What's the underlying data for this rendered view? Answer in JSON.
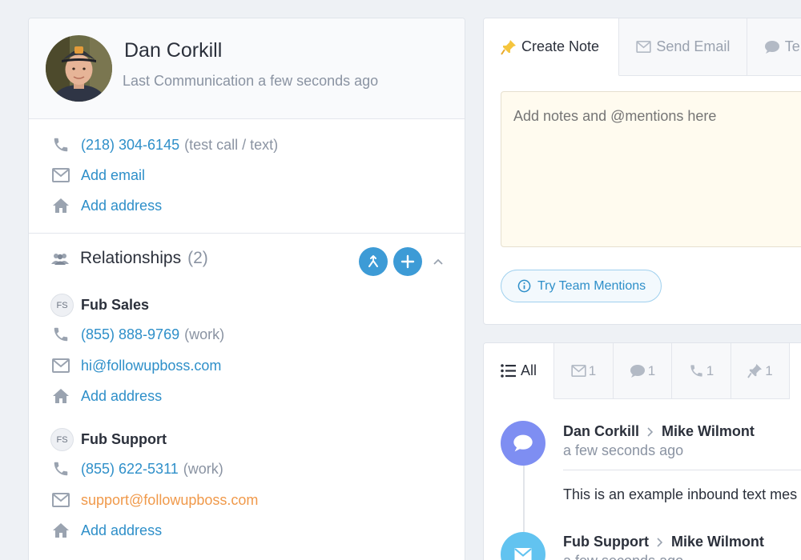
{
  "profile": {
    "name": "Dan Corkill",
    "last_communication": "Last Communication a few seconds ago"
  },
  "contact": {
    "phone": "(218) 304-6145",
    "phone_note": "(test call / text)",
    "add_email": "Add email",
    "add_address": "Add address"
  },
  "relationships": {
    "title": "Relationships",
    "count": "(2)",
    "items": [
      {
        "initials": "FS",
        "name": "Fub Sales",
        "phone": "(855) 888-9769",
        "phone_type": "(work)",
        "email": "hi@followupboss.com",
        "add_address": "Add address"
      },
      {
        "initials": "FS",
        "name": "Fub Support",
        "phone": "(855) 622-5311",
        "phone_type": "(work)",
        "email": "support@followupboss.com",
        "add_address": "Add address"
      }
    ]
  },
  "composer": {
    "tabs": [
      {
        "label": "Create Note",
        "icon": "pin-icon"
      },
      {
        "label": "Send Email",
        "icon": "envelope-icon"
      },
      {
        "label": "Te",
        "icon": "chat-icon"
      }
    ],
    "placeholder": "Add notes and @mentions here",
    "mentions_button": "Try Team Mentions"
  },
  "feed": {
    "tabs": [
      {
        "label": "All",
        "icon": "list-icon"
      },
      {
        "label": "1",
        "icon": "envelope-icon"
      },
      {
        "label": "1",
        "icon": "chat-icon"
      },
      {
        "label": "1",
        "icon": "phone-icon"
      },
      {
        "label": "1",
        "icon": "pin-icon"
      }
    ],
    "entries": [
      {
        "from": "Dan Corkill",
        "to": "Mike Wilmont",
        "time": "a few seconds ago",
        "text": "This is an example inbound text mes",
        "icon": "chat-icon"
      },
      {
        "from": "Fub Support",
        "to": "Mike Wilmont",
        "time": "a few seconds ago",
        "icon": "envelope-icon"
      }
    ]
  },
  "colors": {
    "accent": "#2e8fc9",
    "button_blue": "#3d9bd6",
    "chat_purple": "#7e8ef2",
    "email_blue": "#62c3f0",
    "orange_link": "#f0994a"
  }
}
